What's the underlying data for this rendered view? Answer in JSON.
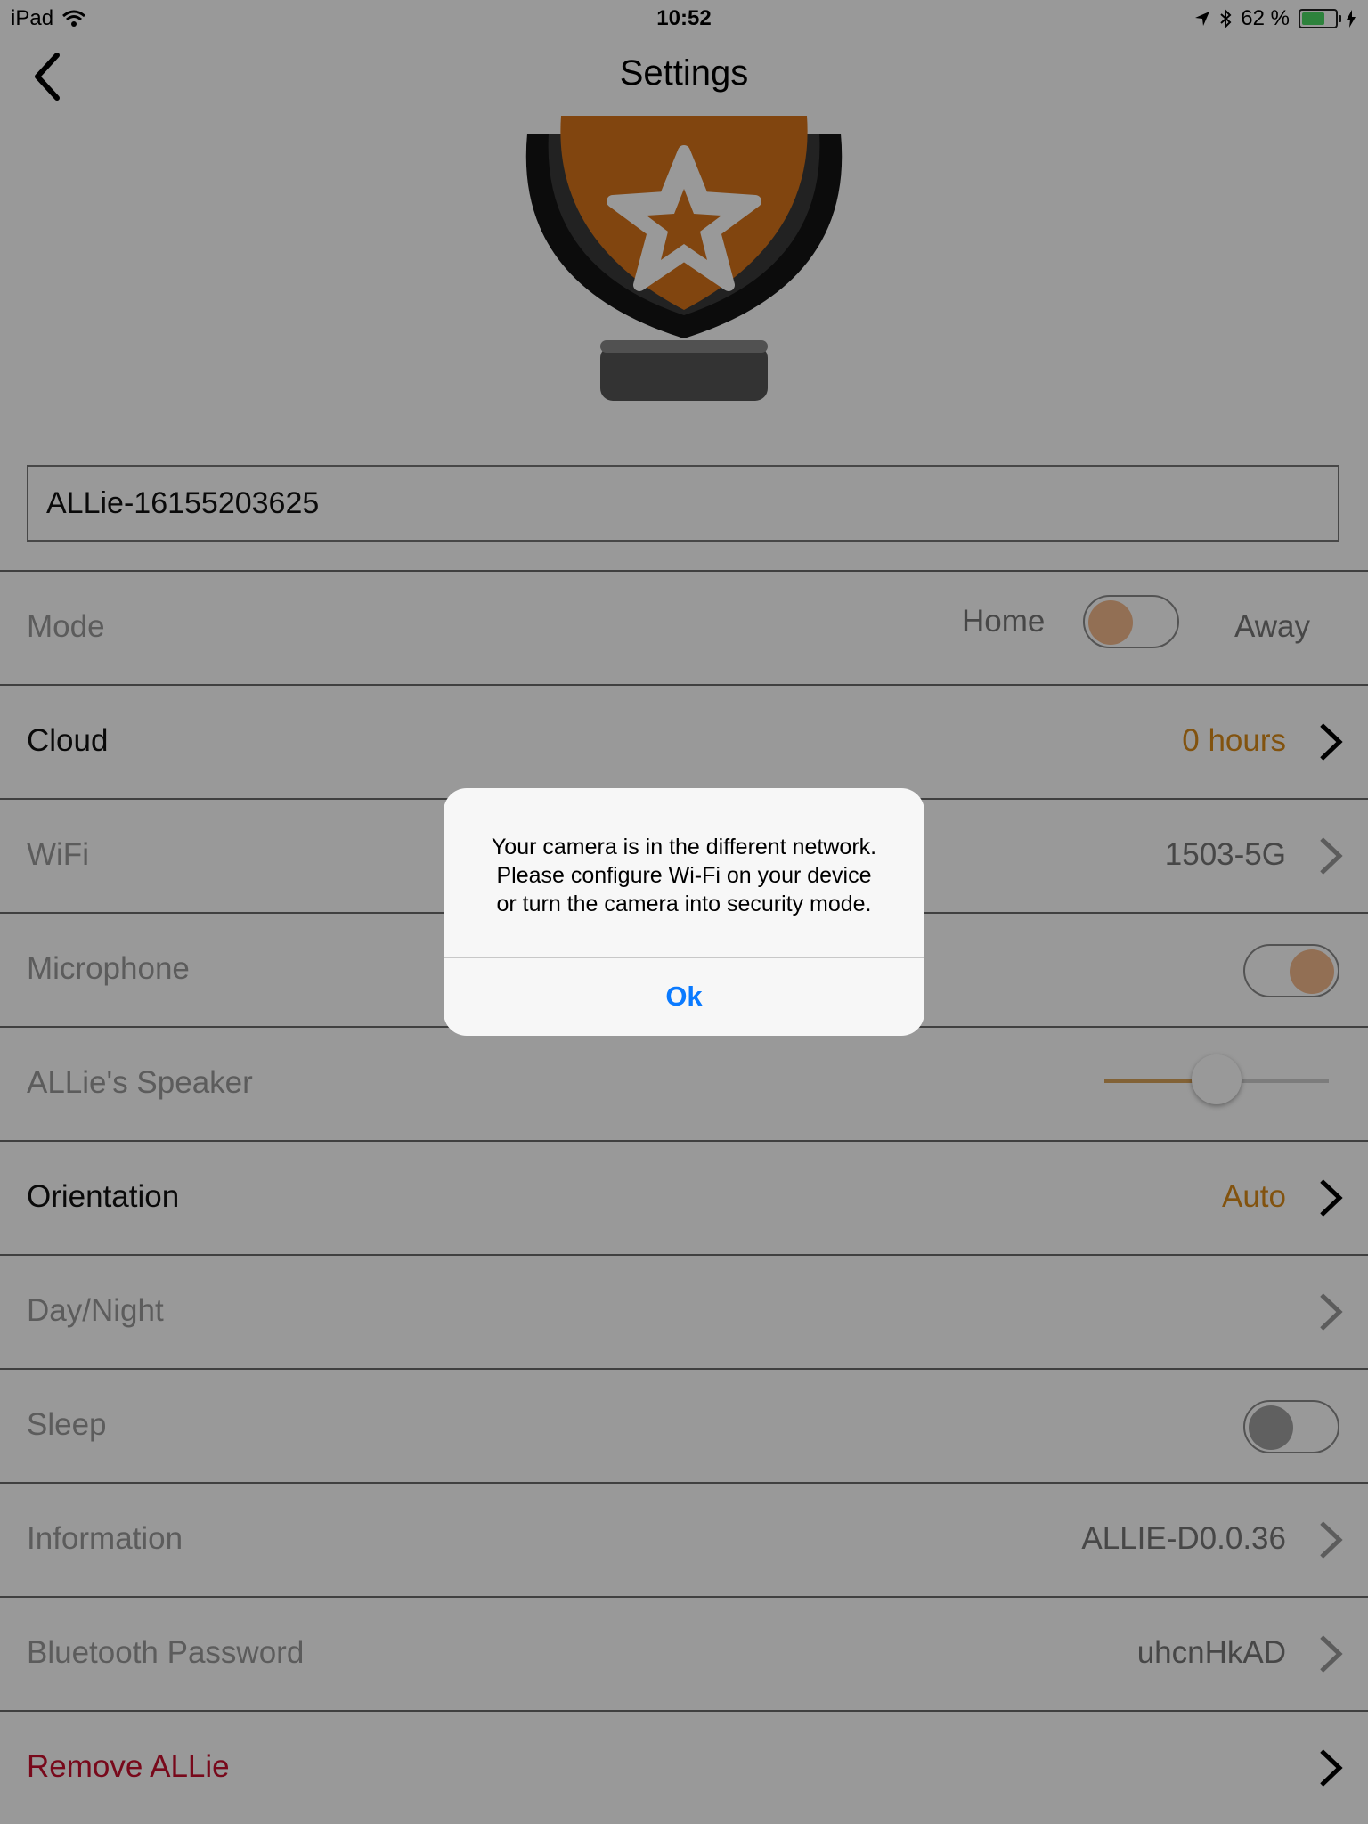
{
  "status_bar": {
    "device": "iPad",
    "time": "10:52",
    "battery_text": "62 %"
  },
  "nav": {
    "title": "Settings"
  },
  "camera_name": "ALLie-16155203625",
  "rows": {
    "mode": {
      "label": "Mode",
      "home": "Home",
      "away": "Away",
      "toggle_on": false
    },
    "cloud": {
      "label": "Cloud",
      "value": "0 hours"
    },
    "wifi": {
      "label": "WiFi",
      "value": "1503-5G"
    },
    "microphone": {
      "label": "Microphone",
      "toggle_on": true
    },
    "speaker": {
      "label": "ALLie's Speaker",
      "level": 0.5
    },
    "orientation": {
      "label": "Orientation",
      "value": "Auto"
    },
    "daynight": {
      "label": "Day/Night"
    },
    "sleep": {
      "label": "Sleep",
      "toggle_on": false
    },
    "information": {
      "label": "Information",
      "value": "ALLIE-D0.0.36"
    },
    "bluetooth": {
      "label": "Bluetooth Password",
      "value": "uhcnHkAD"
    },
    "remove": {
      "label": "Remove ALLie"
    }
  },
  "alert": {
    "message": "Your camera is in the different network.\nPlease configure Wi-Fi on your device\nor turn the camera into security mode.",
    "ok_label": "Ok"
  },
  "colors": {
    "accent_orange": "#d98b1a",
    "remove_red": "#c8102e",
    "alert_button": "#0a7aff"
  }
}
